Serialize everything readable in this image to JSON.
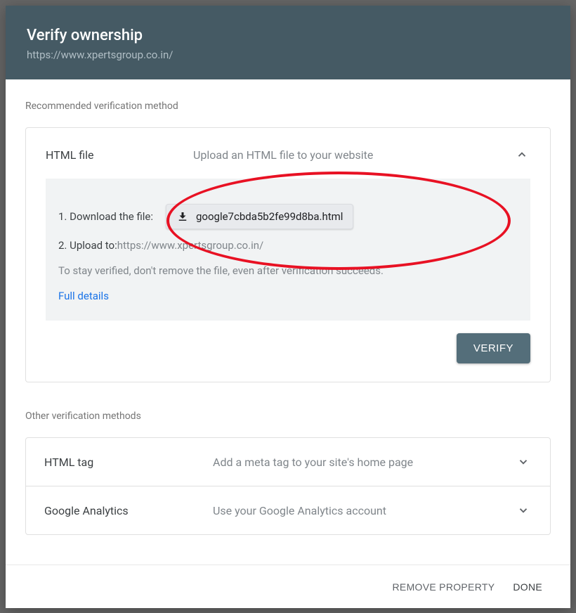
{
  "header": {
    "title": "Verify ownership",
    "url": "https://www.xpertsgroup.co.in/"
  },
  "recommended": {
    "section_label": "Recommended verification method",
    "method_title": "HTML file",
    "method_desc": "Upload an HTML file to your website",
    "step1_label": "1. Download the file:",
    "download_filename": "google7cbda5b2fe99d8ba.html",
    "step2_label": "2. Upload to: ",
    "step2_url": "https://www.xpertsgroup.co.in/",
    "note": "To stay verified, don't remove the file, even after verification succeeds.",
    "details_link": "Full details",
    "verify_button": "VERIFY"
  },
  "other": {
    "section_label": "Other verification methods",
    "methods": [
      {
        "title": "HTML tag",
        "desc": "Add a meta tag to your site's home page"
      },
      {
        "title": "Google Analytics",
        "desc": "Use your Google Analytics account"
      }
    ]
  },
  "footer": {
    "remove": "REMOVE PROPERTY",
    "done": "DONE"
  }
}
